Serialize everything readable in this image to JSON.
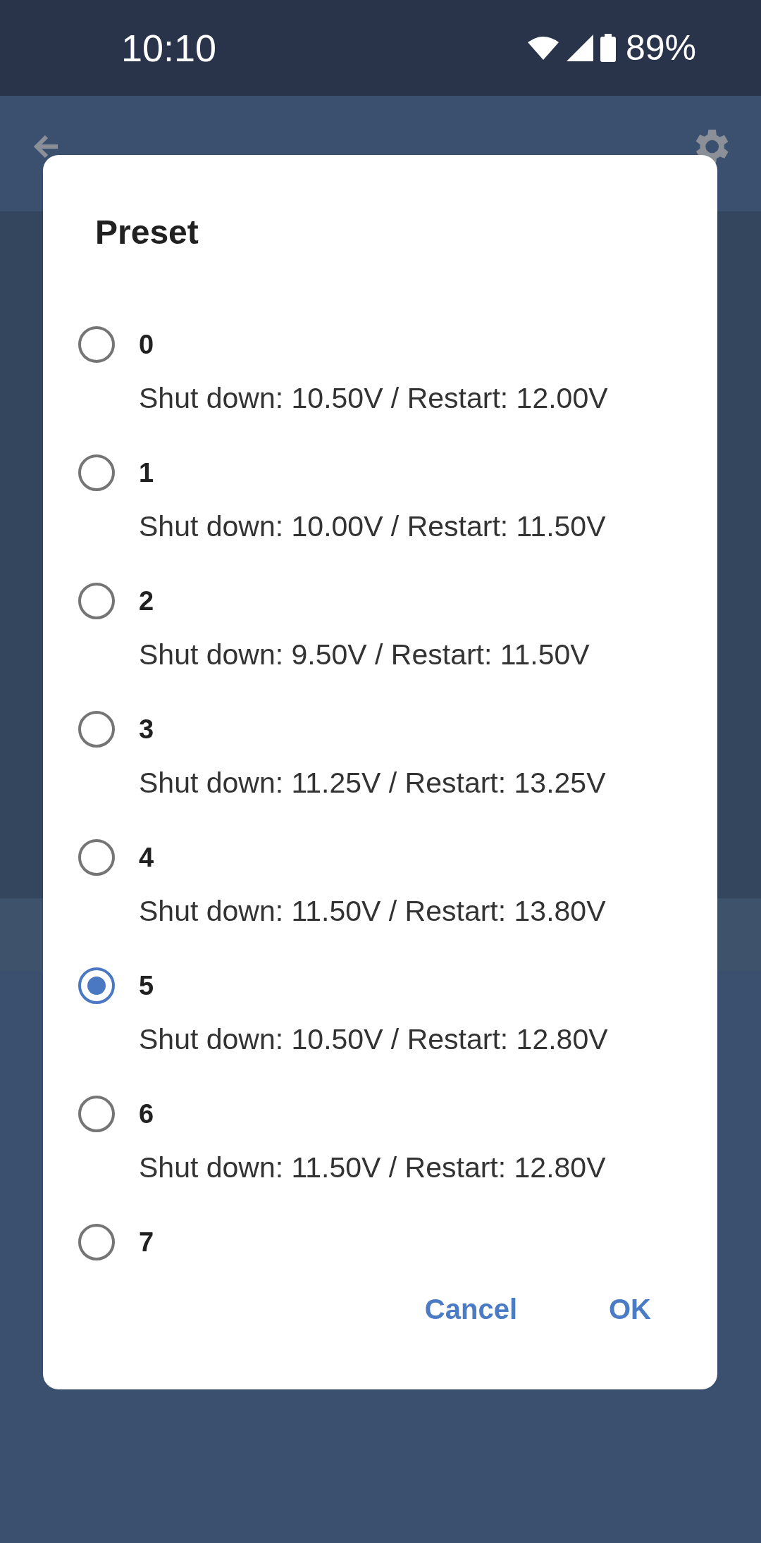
{
  "status_bar": {
    "time": "10:10",
    "battery": "89%"
  },
  "dialog": {
    "title": "Preset",
    "options": [
      {
        "label": "0",
        "detail": "Shut down: 10.50V / Restart: 12.00V",
        "selected": false
      },
      {
        "label": "1",
        "detail": "Shut down: 10.00V / Restart: 11.50V",
        "selected": false
      },
      {
        "label": "2",
        "detail": "Shut down: 9.50V / Restart: 11.50V",
        "selected": false
      },
      {
        "label": "3",
        "detail": "Shut down: 11.25V / Restart: 13.25V",
        "selected": false
      },
      {
        "label": "4",
        "detail": "Shut down: 11.50V / Restart: 13.80V",
        "selected": false
      },
      {
        "label": "5",
        "detail": "Shut down: 10.50V / Restart: 12.80V",
        "selected": true
      },
      {
        "label": "6",
        "detail": "Shut down: 11.50V / Restart: 12.80V",
        "selected": false
      },
      {
        "label": "7",
        "selected": false
      }
    ],
    "buttons": [
      "Cancel",
      "OK"
    ]
  }
}
